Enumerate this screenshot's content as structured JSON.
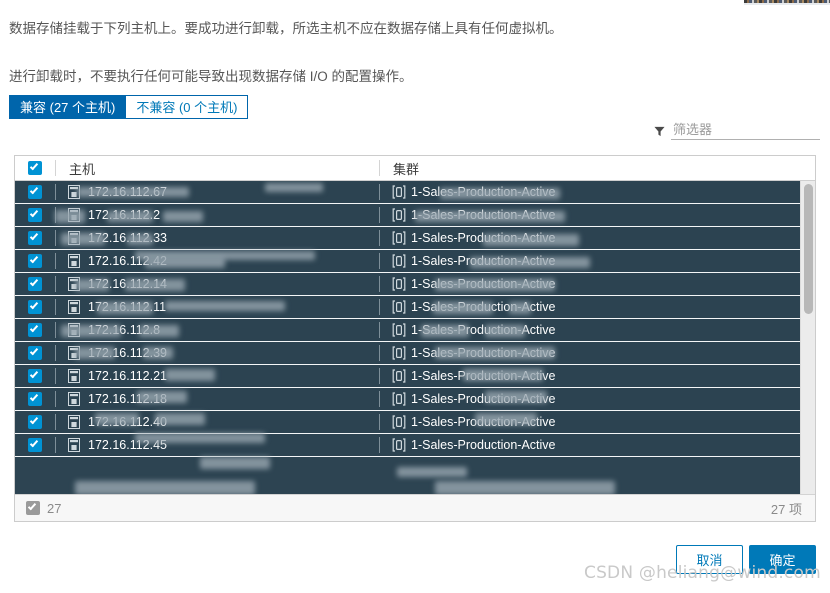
{
  "dialog": {
    "description_line_1": "数据存储挂载于下列主机上。要成功进行卸载，所选主机不应在数据存储上具有任何虚拟机。",
    "description_line_2": "进行卸载时，不要执行任何可能导致出现数据存储 I/O 的配置操作。"
  },
  "tabs": [
    {
      "label": "兼容 (27 个主机)",
      "state": "active"
    },
    {
      "label": "不兼容 (0 个主机)",
      "state": "inactive"
    }
  ],
  "filter": {
    "icon": "funnel-icon",
    "placeholder": "筛选器",
    "value": ""
  },
  "table": {
    "columns": [
      {
        "key": "host",
        "label": "主机"
      },
      {
        "key": "cluster",
        "label": "集群"
      }
    ],
    "header_checkbox_checked": true,
    "rows": [
      {
        "checked": true,
        "host": "172.16.112.67",
        "cluster": "1-Sales-Production-Active"
      },
      {
        "checked": true,
        "host": "172.16.112.2",
        "cluster": "1-Sales-Production-Active"
      },
      {
        "checked": true,
        "host": "172.16.112.33",
        "cluster": "1-Sales-Production-Active"
      },
      {
        "checked": true,
        "host": "172.16.112.42",
        "cluster": "1-Sales-Production-Active"
      },
      {
        "checked": true,
        "host": "172.16.112.14",
        "cluster": "1-Sales-Production-Active"
      },
      {
        "checked": true,
        "host": "172.16.112.11",
        "cluster": "1-Sales-Production-Active"
      },
      {
        "checked": true,
        "host": "172.16.112.8",
        "cluster": "1-Sales-Production-Active"
      },
      {
        "checked": true,
        "host": "172.16.112.39",
        "cluster": "1-Sales-Production-Active"
      },
      {
        "checked": true,
        "host": "172.16.112.21",
        "cluster": "1-Sales-Production-Active"
      },
      {
        "checked": true,
        "host": "172.16.112.18",
        "cluster": "1-Sales-Production-Active"
      },
      {
        "checked": true,
        "host": "172.16.112.40",
        "cluster": "1-Sales-Production-Active"
      },
      {
        "checked": true,
        "host": "172.16.112.45",
        "cluster": "1-Sales-Production-Active"
      }
    ],
    "footer": {
      "selected_count": "27",
      "total_label": "27 项",
      "footer_checkbox_checked": true
    }
  },
  "buttons": {
    "cancel": "取消",
    "ok": "确定"
  },
  "watermark": "CSDN @heliang@wind.com",
  "colors": {
    "accent": "#0079b8",
    "tab_active": "#0065ab",
    "row_bg": "#2c4351",
    "checkbox": "#0093d4"
  }
}
